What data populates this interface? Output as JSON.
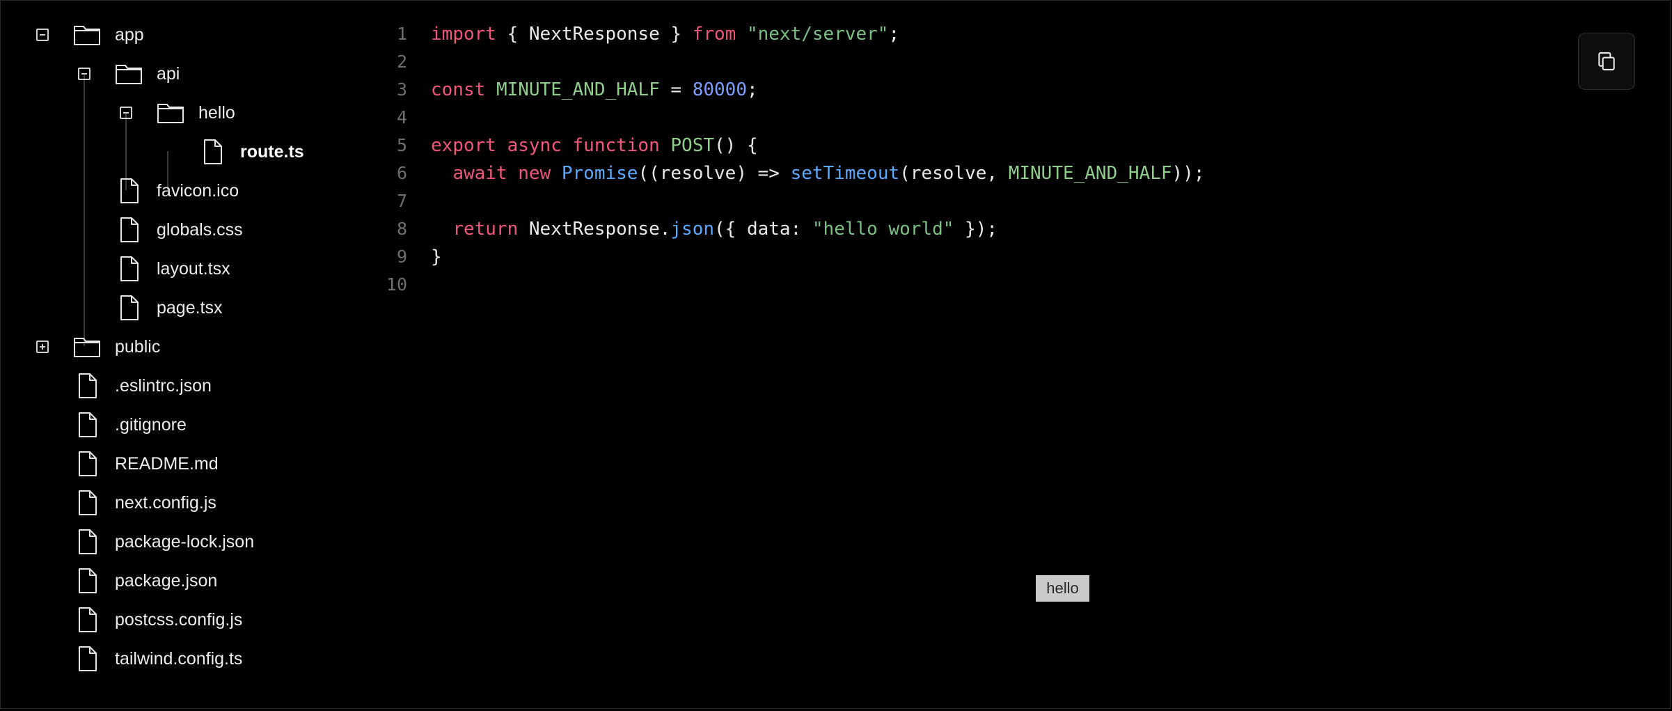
{
  "file_tree": {
    "items": [
      {
        "label": "app",
        "kind": "folder",
        "toggle": "collapse"
      },
      {
        "label": "api",
        "kind": "folder",
        "toggle": "collapse"
      },
      {
        "label": "hello",
        "kind": "folder",
        "toggle": "collapse"
      },
      {
        "label": "route.ts",
        "kind": "file",
        "selected": true
      },
      {
        "label": "favicon.ico",
        "kind": "file"
      },
      {
        "label": "globals.css",
        "kind": "file"
      },
      {
        "label": "layout.tsx",
        "kind": "file"
      },
      {
        "label": "page.tsx",
        "kind": "file"
      },
      {
        "label": "public",
        "kind": "folder",
        "toggle": "expand"
      },
      {
        "label": ".eslintrc.json",
        "kind": "file"
      },
      {
        "label": ".gitignore",
        "kind": "file"
      },
      {
        "label": "README.md",
        "kind": "file"
      },
      {
        "label": "next.config.js",
        "kind": "file"
      },
      {
        "label": "package-lock.json",
        "kind": "file"
      },
      {
        "label": "package.json",
        "kind": "file"
      },
      {
        "label": "postcss.config.js",
        "kind": "file"
      },
      {
        "label": "tailwind.config.ts",
        "kind": "file"
      }
    ]
  },
  "code": {
    "line_numbers": [
      "1",
      "2",
      "3",
      "4",
      "5",
      "6",
      "7",
      "8",
      "9",
      "10"
    ],
    "lines": [
      [
        [
          "kw",
          "import"
        ],
        [
          "def",
          " { NextResponse } "
        ],
        [
          "kw",
          "from"
        ],
        [
          "def",
          " "
        ],
        [
          "str",
          "\"next/server\""
        ],
        [
          "def",
          ";"
        ]
      ],
      [],
      [
        [
          "kw",
          "const"
        ],
        [
          "def",
          " "
        ],
        [
          "con",
          "MINUTE_AND_HALF"
        ],
        [
          "def",
          " = "
        ],
        [
          "num",
          "80000"
        ],
        [
          "def",
          ";"
        ]
      ],
      [],
      [
        [
          "kw",
          "export"
        ],
        [
          "def",
          " "
        ],
        [
          "kw",
          "async"
        ],
        [
          "def",
          " "
        ],
        [
          "kw",
          "function"
        ],
        [
          "def",
          " "
        ],
        [
          "con",
          "POST"
        ],
        [
          "def",
          "() {"
        ]
      ],
      [
        [
          "def",
          "  "
        ],
        [
          "kw",
          "await"
        ],
        [
          "def",
          " "
        ],
        [
          "kw",
          "new"
        ],
        [
          "def",
          " "
        ],
        [
          "fn",
          "Promise"
        ],
        [
          "def",
          "((resolve) => "
        ],
        [
          "fn",
          "setTimeout"
        ],
        [
          "def",
          "(resolve, "
        ],
        [
          "con",
          "MINUTE_AND_HALF"
        ],
        [
          "def",
          "));"
        ]
      ],
      [],
      [
        [
          "def",
          "  "
        ],
        [
          "kw",
          "return"
        ],
        [
          "def",
          " NextResponse."
        ],
        [
          "fn",
          "json"
        ],
        [
          "def",
          "({ data: "
        ],
        [
          "str",
          "\"hello world\""
        ],
        [
          "def",
          " });"
        ]
      ],
      [
        [
          "def",
          "}"
        ]
      ],
      []
    ]
  },
  "toolbar": {
    "copy_icon": "copy-icon"
  },
  "tooltip": {
    "text": "hello"
  },
  "colors": {
    "background": "#000000",
    "keyword": "#f0567a",
    "string": "#7bbf85",
    "number": "#7c9eff",
    "function": "#5aa9ff",
    "constant": "#8fce8b"
  }
}
